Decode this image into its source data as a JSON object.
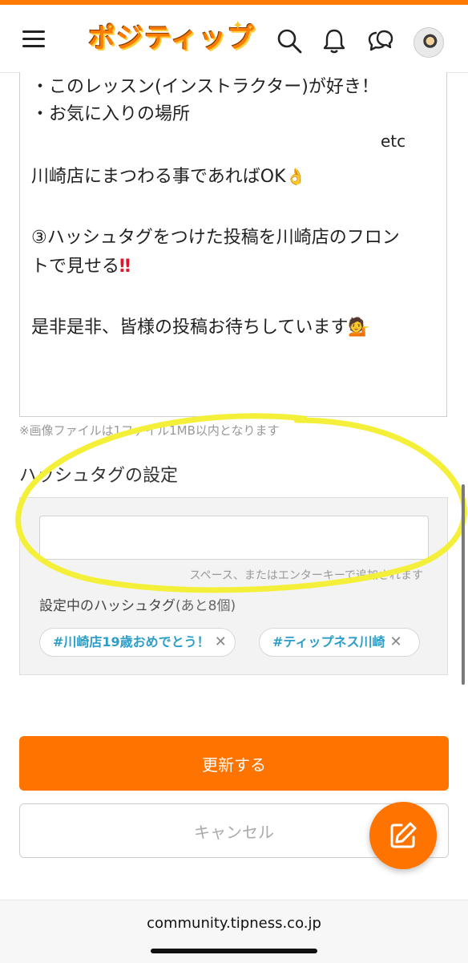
{
  "header": {
    "logo_text": "ポジティップ",
    "icons": [
      "menu-icon",
      "search-icon",
      "bell-icon",
      "chat-icon",
      "avatar"
    ]
  },
  "post_body": {
    "lines": [
      "・このレッスン(インストラクター)が好き！",
      "・お気に入りの場所",
      "etc",
      "川崎店にまつわる事であればOK",
      "③ハッシュタグをつけた投稿を川崎店のフロン",
      "トで見せる",
      "是非是非、皆様の投稿お待ちしています"
    ],
    "emoji_ok": "👌",
    "emoji_exclaim": "‼",
    "emoji_person": "💁"
  },
  "image_note": "※画像ファイルは1ファイル1MB以内となります",
  "hashtag": {
    "section_title": "ハッシュタグの設定",
    "input_value": "",
    "hint": "スペース、またはエンターキーで追加されます",
    "count_label": "設定中のハッシュタグ",
    "count_remaining": "(あと8個)",
    "tags": [
      "#川崎店19歳おめでとう！",
      "#ティップネス川崎"
    ],
    "remove_symbol": "✕"
  },
  "actions": {
    "update_label": "更新する",
    "cancel_label": "キャンセル"
  },
  "browser": {
    "url": "community.tipness.co.jp"
  },
  "colors": {
    "accent": "#ff7400",
    "tag_text": "#2d9ec8",
    "annotation": "#f4f03a"
  }
}
